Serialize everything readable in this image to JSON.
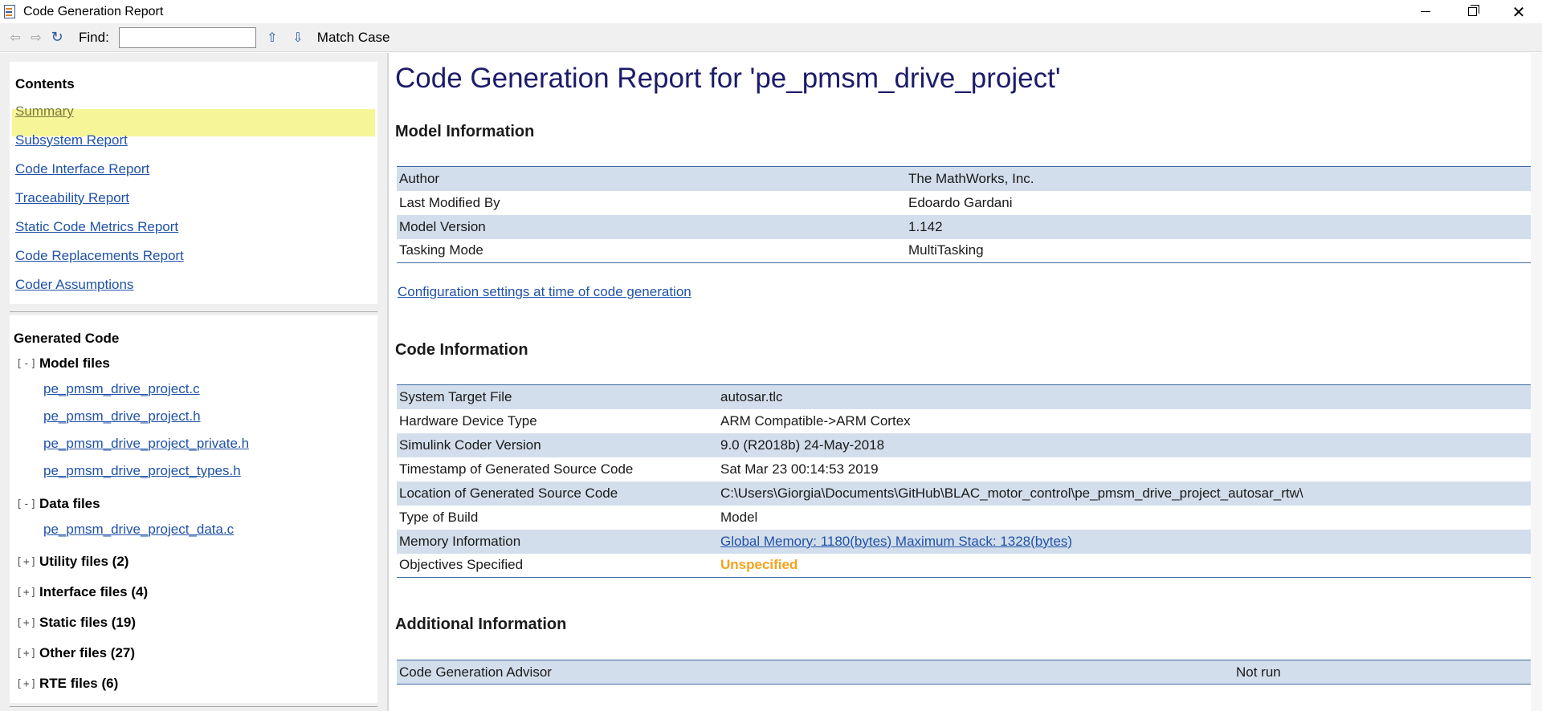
{
  "window": {
    "title": "Code Generation Report"
  },
  "toolbar": {
    "find_label": "Find:",
    "find_value": "",
    "match_case": "Match Case"
  },
  "contents": {
    "title": "Contents",
    "items": [
      {
        "label": "Summary"
      },
      {
        "label": "Subsystem Report"
      },
      {
        "label": "Code Interface Report"
      },
      {
        "label": "Traceability Report"
      },
      {
        "label": "Static Code Metrics Report"
      },
      {
        "label": "Code Replacements Report"
      },
      {
        "label": "Coder Assumptions"
      }
    ]
  },
  "generated": {
    "title": "Generated Code",
    "expanded_toggle": "[-]",
    "collapsed_toggle": "[+]",
    "model_files": {
      "label": "Model files",
      "files": [
        "pe_pmsm_drive_project.c",
        "pe_pmsm_drive_project.h",
        "pe_pmsm_drive_project_private.h",
        "pe_pmsm_drive_project_types.h"
      ]
    },
    "data_files": {
      "label": "Data files",
      "files": [
        "pe_pmsm_drive_project_data.c"
      ]
    },
    "collapsed_groups": [
      {
        "label": "Utility files (2)"
      },
      {
        "label": "Interface files (4)"
      },
      {
        "label": "Static files (19)"
      },
      {
        "label": "Other files (27)"
      },
      {
        "label": "RTE files (6)"
      }
    ]
  },
  "report": {
    "title": "Code Generation Report for 'pe_pmsm_drive_project'",
    "model_info": {
      "heading": "Model Information",
      "rows": [
        {
          "key": "Author",
          "value": "The MathWorks, Inc."
        },
        {
          "key": "Last Modified By",
          "value": "Edoardo Gardani"
        },
        {
          "key": "Model Version",
          "value": "1.142"
        },
        {
          "key": "Tasking Mode",
          "value": "MultiTasking"
        }
      ]
    },
    "config_link": "Configuration settings at time of code generation",
    "code_info": {
      "heading": "Code Information",
      "rows": [
        {
          "key": "System Target File",
          "value": "autosar.tlc"
        },
        {
          "key": "Hardware Device Type",
          "value": "ARM Compatible->ARM Cortex"
        },
        {
          "key": "Simulink Coder Version",
          "value": "9.0 (R2018b) 24-May-2018"
        },
        {
          "key": "Timestamp of Generated Source Code",
          "value": "Sat Mar 23 00:14:53 2019"
        },
        {
          "key": "Location of Generated Source Code",
          "value": "C:\\Users\\Giorgia\\Documents\\GitHub\\BLAC_motor_control\\pe_pmsm_drive_project_autosar_rtw\\"
        },
        {
          "key": "Type of Build",
          "value": "Model"
        },
        {
          "key": "Memory Information",
          "value": "Global Memory: 1180(bytes) Maximum Stack: 1328(bytes)"
        },
        {
          "key": "Objectives Specified",
          "value": "Unspecified"
        }
      ]
    },
    "additional_info": {
      "heading": "Additional Information",
      "rows": [
        {
          "key": "Code Generation Advisor",
          "value": "Not run"
        }
      ]
    }
  }
}
